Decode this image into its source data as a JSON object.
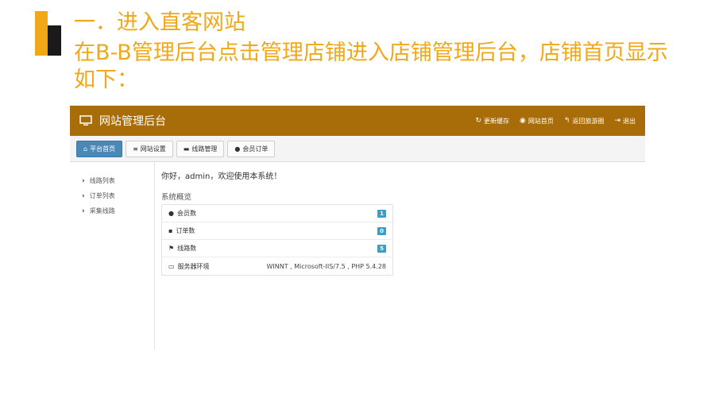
{
  "slide": {
    "title": "一．进入直客网站",
    "description": "在B-B管理后台点击管理店铺进入店铺管理后台，店铺首页显示如下："
  },
  "navbar": {
    "brand": "网站管理后台",
    "links": [
      {
        "icon": "↻",
        "label": "更新缓存"
      },
      {
        "icon": "◉",
        "label": "网站首页"
      },
      {
        "icon": "↰",
        "label": "返回旅游圈"
      },
      {
        "icon": "⇥",
        "label": "退出"
      }
    ]
  },
  "toolbar": {
    "buttons": [
      {
        "icon": "⌂",
        "label": "平台首页"
      },
      {
        "icon": "≡",
        "label": "网站设置"
      },
      {
        "icon": "▬",
        "label": "线路管理"
      },
      {
        "icon": "●",
        "label": "会员订单"
      }
    ]
  },
  "sidebar": {
    "items": [
      {
        "label": "线路列表"
      },
      {
        "label": "订单列表"
      },
      {
        "label": "采集线路"
      }
    ]
  },
  "main": {
    "welcome": "你好，admin，欢迎使用本系统！",
    "overview_title": "系统概览",
    "stats": [
      {
        "icon": "●",
        "label": "会员数",
        "value": "1"
      },
      {
        "icon": "▪",
        "label": "订单数",
        "value": "0"
      },
      {
        "icon": "⚑",
        "label": "线路数",
        "value": "5"
      }
    ],
    "env": {
      "icon": "▭",
      "label": "服务器环境",
      "value": "WINNT , Microsoft-IIS/7.5 , PHP 5.4.28"
    }
  },
  "colors": {
    "accent": "#f0a818",
    "navbar": "#a86c08",
    "active_button": "#4a88b8",
    "badge": "#3a9ec6"
  }
}
